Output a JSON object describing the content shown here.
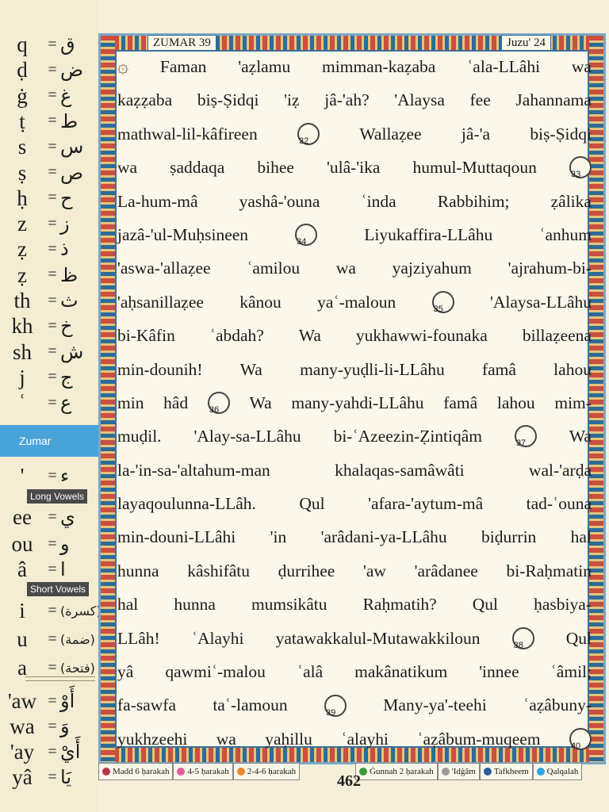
{
  "header": {
    "surah": "ZUMAR 39",
    "juz": "Juzu' 24"
  },
  "key": {
    "consonants": [
      {
        "lat": "q",
        "ar": "ق"
      },
      {
        "lat": "ḍ",
        "ar": "ض"
      },
      {
        "lat": "ġ",
        "ar": "غ"
      },
      {
        "lat": "ṭ",
        "ar": "ط"
      },
      {
        "lat": "s",
        "ar": "س"
      },
      {
        "lat": "ṣ",
        "ar": "ص"
      },
      {
        "lat": "ḥ",
        "ar": "ح"
      },
      {
        "lat": "z",
        "ar": "ز"
      },
      {
        "lat": "ẓ",
        "ar": "ذ"
      },
      {
        "lat": "ẓ",
        "ar": "ظ"
      },
      {
        "lat": "th",
        "ar": "ث"
      },
      {
        "lat": "kh",
        "ar": "خ"
      },
      {
        "lat": "sh",
        "ar": "ش"
      },
      {
        "lat": "j",
        "ar": "ج"
      },
      {
        "lat": "ʿ",
        "ar": "ع"
      }
    ],
    "surah_tab": "Zumar",
    "hamza": {
      "lat": "'",
      "ar": "ء"
    },
    "long_vowels_label": "Long Vowels",
    "long_vowels": [
      {
        "lat": "ee",
        "ar": "ي"
      },
      {
        "lat": "ou",
        "ar": "و"
      },
      {
        "lat": "â",
        "ar": "ا"
      }
    ],
    "short_vowels_label": "Short Vowels",
    "short_vowels": [
      {
        "lat": "i",
        "ar": "(كسرة)"
      },
      {
        "lat": "u",
        "ar": "(ضمة)"
      },
      {
        "lat": "a",
        "ar": "(فتحة)"
      }
    ],
    "diphthongs": [
      {
        "lat": "'aw",
        "ar": "أَوْ"
      },
      {
        "lat": "wa",
        "ar": "وَ"
      },
      {
        "lat": "'ay",
        "ar": "أَيْ"
      },
      {
        "lat": "yâ",
        "ar": "يَا"
      }
    ]
  },
  "lines": [
    "Faman 'aẓlamu mimman-kaẓaba ʿala-LLâhi wa",
    "kaẓẓaba biṣ-Ṣidqi 'iẓ jâ-'ah? 'Alaysa fee Jahannama",
    "mathwal-lil-kâfireen|32|Wallaẓee jâ-'a biṣ-Ṣidqi",
    "wa ṣaddaqa bihee 'ulâ-'ika humul-Muttaqoun|33",
    "La-hum-mâ yashâ-'ouna ʿinda Rabbihim; ẓâlika",
    "jazâ-'ul-Muḥsineen|34|Liyukaffira-LLâhu ʿanhum",
    "'aswa-'allaẓee ʿamilou wa yajziyahum 'ajrahum-bi-",
    "'aḥsanillaẓee kânou yaʿ-maloun|35|'Alaysa-LLâhu",
    "bi-Kâfin ʿabdah? Wa yukhawwi-founaka billaẓeena",
    "min-dounih! Wa many-yuḍli-li-LLâhu famâ lahou",
    "min hâd|36|Wa many-yahdi-LLâhu famâ lahou mim-",
    "muḍil. 'Alay-sa-LLâhu bi-ʿAzeezin-Ẓintiqâm|37|Wa",
    "la-'in-sa-'altahum-man khalaqas-samâwâti wal-'arḍa",
    "layaqoulunna-LLâh. Qul 'afara-'aytum-mâ tad-ʿouna",
    "min-douni-LLâhi 'in 'arâdani-ya-LLâhu biḍurrin hal",
    "hunna kâshifâtu ḍurrihee 'aw 'arâdanee bi-Raḥmatin",
    "hal hunna mumsikâtu Raḥmatih? Qul ḥasbiya-",
    "LLâh! ʿAlayhi yatawakkalul-Mutawakkiloun|38|Qul",
    "yâ qawmiʿ-malou ʿalâ makânatikum 'innee ʿâmil;",
    "fa-sawfa taʿ-lamoun|39|Many-ya'-teehi ʿaẓâbuny-",
    "yukhzeehi wa yaḥillu ʿalayhi ʿaẓâbum-muqeem|40"
  ],
  "legend": [
    {
      "label": "Madd 6 ḥarakah",
      "color": "#b5364b"
    },
    {
      "label": "4-5 ḥarakah",
      "color": "#e35a9c"
    },
    {
      "label": "2-4-6 ḥarakah",
      "color": "#f08a2c"
    },
    {
      "label": "Ġunnah 2 ḥarakah",
      "color": "#3b9a3b"
    },
    {
      "label": "'Idġâm",
      "color": "#9a9a9a"
    },
    {
      "label": "Tafkheem",
      "color": "#2e5d9a"
    },
    {
      "label": "Qalqalah",
      "color": "#2aa7e0"
    }
  ],
  "page_number": "462"
}
